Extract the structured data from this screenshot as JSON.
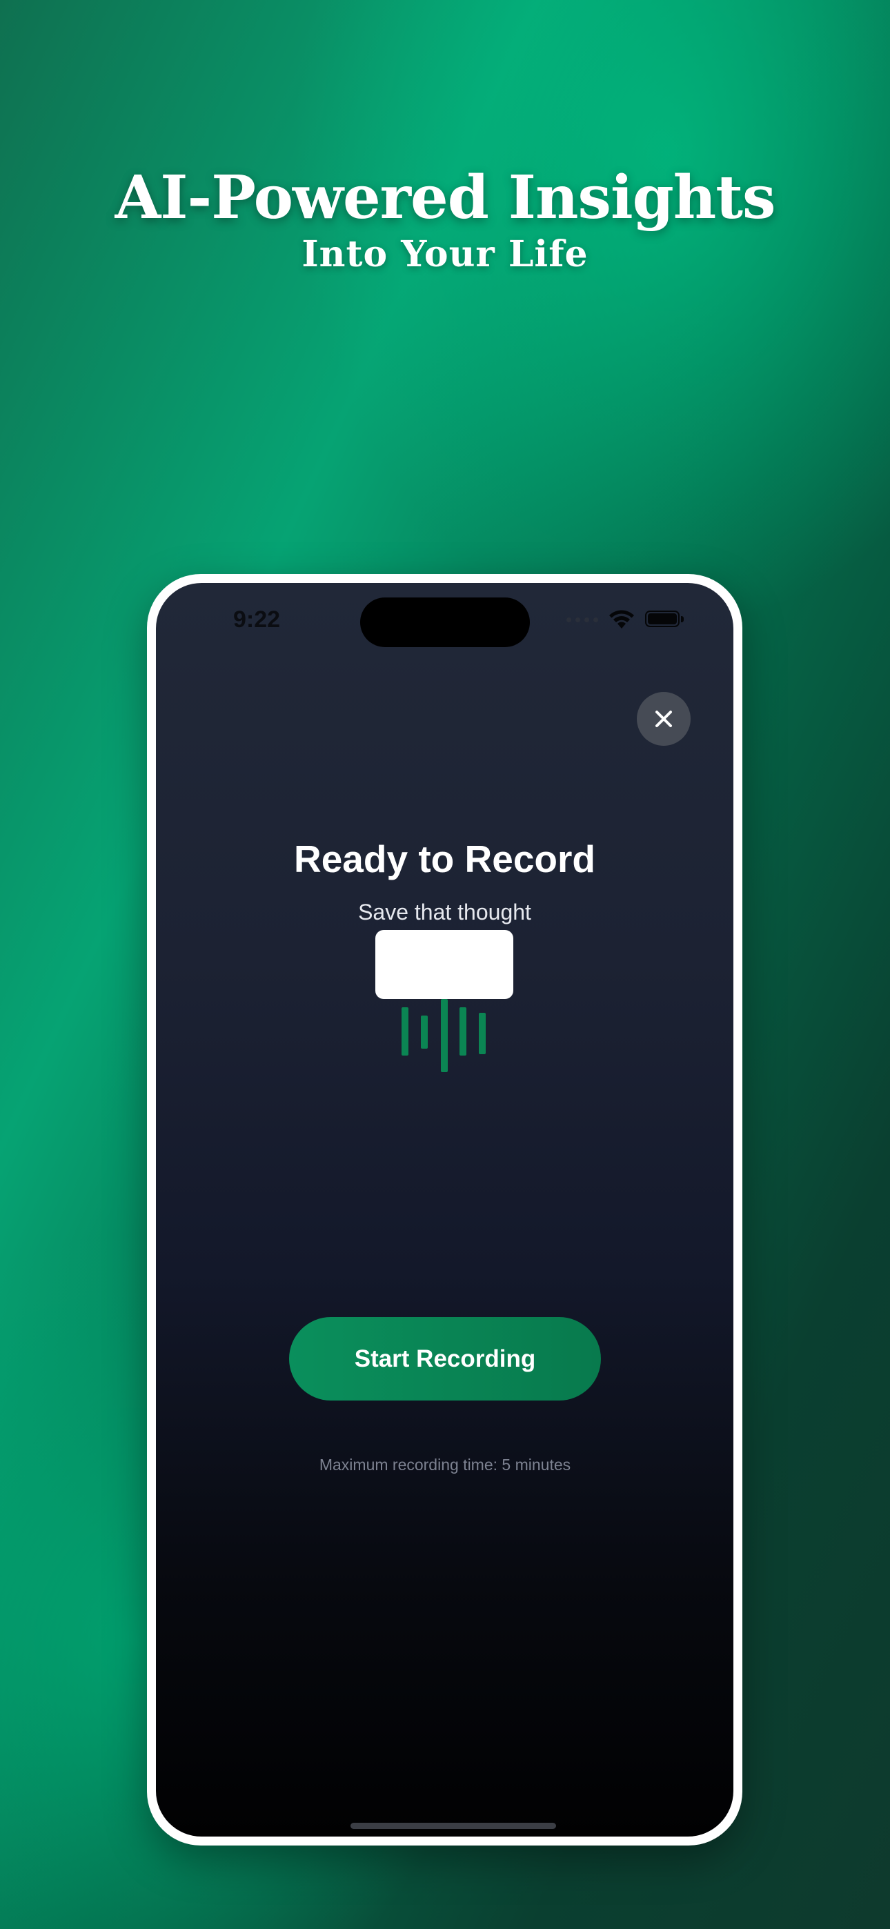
{
  "marketing": {
    "headline": "AI-Powered Insights",
    "subheadline": "Into Your Life"
  },
  "status_bar": {
    "time": "9:22",
    "icons": [
      "signal-dots-icon",
      "wifi-icon",
      "battery-icon"
    ]
  },
  "recorder": {
    "close_icon": "close-icon",
    "illustration_icon": "microphone-waveform-icon",
    "title": "Ready to Record",
    "subtitle": "Save that thought",
    "start_button_label": "Start Recording",
    "hint": "Maximum recording time: 5 minutes"
  },
  "colors": {
    "accent": "#0a8f5c",
    "screen_top": "#212838",
    "screen_bottom": "#010102",
    "background_green": "#06a373"
  }
}
